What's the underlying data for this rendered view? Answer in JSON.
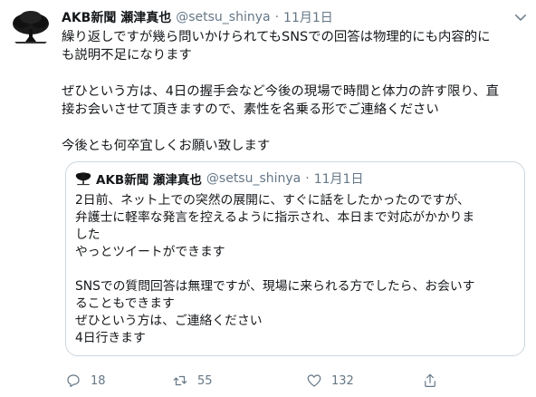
{
  "tweet": {
    "author_name": "AKB新聞 瀬津真也",
    "handle": "@setsu_shinya",
    "separator": "·",
    "date": "11月1日",
    "lines": [
      "繰り返しですが幾ら問いかけられてもSNSでの回答は物理的にも内容的に",
      "も説明不足になります",
      "",
      "ぜひという方は、4日の握手会など今後の現場で時間と体力の許す限り、直",
      "接お会いさせて頂きますので、素性を名乗る形でご連絡ください",
      "",
      "今後とも何卒宜しくお願い致します"
    ]
  },
  "quoted": {
    "author_name": "AKB新聞 瀬津真也",
    "handle": "@setsu_shinya",
    "separator": "·",
    "date": "11月1日",
    "lines": [
      "2日前、ネット上での突然の展開に、すぐに話をしたかったのですが、",
      "弁護士に軽率な発言を控えるように指示され、本日まで対応がかかりま",
      "した",
      "やっとツイートができます",
      "",
      "SNSでの質問回答は無理ですが、現場に来られる方でしたら、お会いす",
      "ることもできます",
      "ぜひという方は、ご連絡ください",
      "4日行きます"
    ]
  },
  "actions": {
    "reply_count": "18",
    "retweet_count": "55",
    "like_count": "132"
  },
  "colors": {
    "text": "#14171a",
    "muted": "#657786",
    "border": "#ccd6dd"
  },
  "icons": [
    "tree-avatar-icon",
    "chevron-down-icon",
    "reply-icon",
    "retweet-icon",
    "like-icon",
    "share-icon"
  ]
}
